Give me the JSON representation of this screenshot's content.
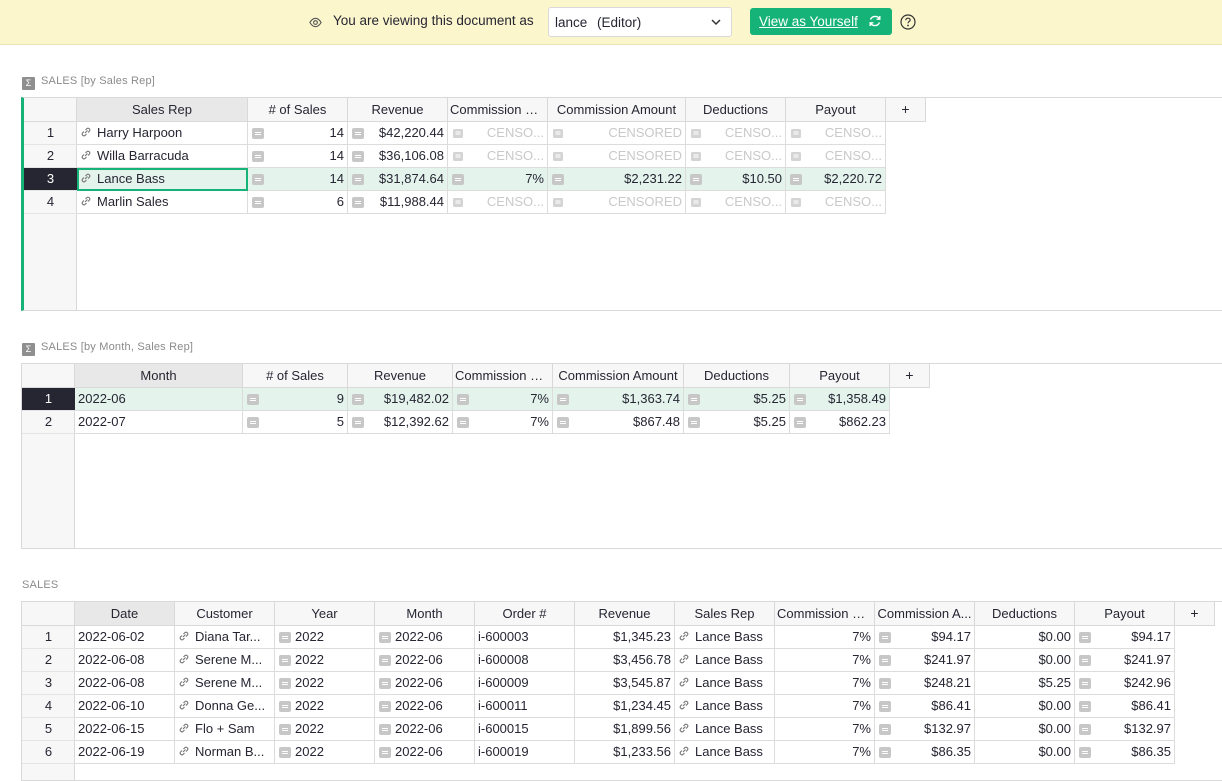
{
  "banner": {
    "message": "You are viewing this document as",
    "user": "lance",
    "role": "(Editor)",
    "button": "View as Yourself"
  },
  "colors": {
    "accent": "#16b378",
    "banner_bg": "#fcf6cd",
    "selected_row": "#e4f4ec"
  },
  "sections": [
    {
      "title": "SALES [by Sales Rep]",
      "summary": true,
      "columns": [
        "Sales Rep",
        "# of Sales",
        "Revenue",
        "Commission R...",
        "Commission Amount",
        "Deductions",
        "Payout"
      ],
      "rows": [
        {
          "num": "1",
          "cells": [
            "Harry Harpoon",
            "14",
            "$42,220.44",
            "CENSO...",
            "CENSORED",
            "CENSO...",
            "CENSO..."
          ]
        },
        {
          "num": "2",
          "cells": [
            "Willa Barracuda",
            "14",
            "$36,106.08",
            "CENSO...",
            "CENSORED",
            "CENSO...",
            "CENSO..."
          ]
        },
        {
          "num": "3",
          "cells": [
            "Lance Bass",
            "14",
            "$31,874.64",
            "7%",
            "$2,231.22",
            "$10.50",
            "$2,220.72"
          ]
        },
        {
          "num": "4",
          "cells": [
            "Marlin Sales",
            "6",
            "$11,988.44",
            "CENSO...",
            "CENSORED",
            "CENSO...",
            "CENSO..."
          ]
        }
      ]
    },
    {
      "title": "SALES [by Month, Sales Rep]",
      "summary": true,
      "columns": [
        "Month",
        "# of Sales",
        "Revenue",
        "Commission R...",
        "Commission Amount",
        "Deductions",
        "Payout"
      ],
      "rows": [
        {
          "num": "1",
          "cells": [
            "2022-06",
            "9",
            "$19,482.02",
            "7%",
            "$1,363.74",
            "$5.25",
            "$1,358.49"
          ]
        },
        {
          "num": "2",
          "cells": [
            "2022-07",
            "5",
            "$12,392.62",
            "7%",
            "$867.48",
            "$5.25",
            "$862.23"
          ]
        }
      ]
    },
    {
      "title": "SALES",
      "summary": false,
      "columns": [
        "Date",
        "Customer",
        "Year",
        "Month",
        "Order #",
        "Revenue",
        "Sales Rep",
        "Commission R...",
        "Commission A...",
        "Deductions",
        "Payout"
      ],
      "rows": [
        {
          "num": "1",
          "cells": [
            "2022-06-02",
            "Diana Tar...",
            "2022",
            "2022-06",
            "i-600003",
            "$1,345.23",
            "Lance Bass",
            "7%",
            "$94.17",
            "$0.00",
            "$94.17"
          ]
        },
        {
          "num": "2",
          "cells": [
            "2022-06-08",
            "Serene M...",
            "2022",
            "2022-06",
            "i-600008",
            "$3,456.78",
            "Lance Bass",
            "7%",
            "$241.97",
            "$0.00",
            "$241.97"
          ]
        },
        {
          "num": "3",
          "cells": [
            "2022-06-08",
            "Serene M...",
            "2022",
            "2022-06",
            "i-600009",
            "$3,545.87",
            "Lance Bass",
            "7%",
            "$248.21",
            "$5.25",
            "$242.96"
          ]
        },
        {
          "num": "4",
          "cells": [
            "2022-06-10",
            "Donna Ge...",
            "2022",
            "2022-06",
            "i-600011",
            "$1,234.45",
            "Lance Bass",
            "7%",
            "$86.41",
            "$0.00",
            "$86.41"
          ]
        },
        {
          "num": "5",
          "cells": [
            "2022-06-15",
            "Flo + Sam",
            "2022",
            "2022-06",
            "i-600015",
            "$1,899.56",
            "Lance Bass",
            "7%",
            "$132.97",
            "$0.00",
            "$132.97"
          ]
        },
        {
          "num": "6",
          "cells": [
            "2022-06-19",
            "Norman B...",
            "2022",
            "2022-06",
            "i-600019",
            "$1,233.56",
            "Lance Bass",
            "7%",
            "$86.35",
            "$0.00",
            "$86.35"
          ]
        }
      ]
    }
  ],
  "add_column_label": "+"
}
